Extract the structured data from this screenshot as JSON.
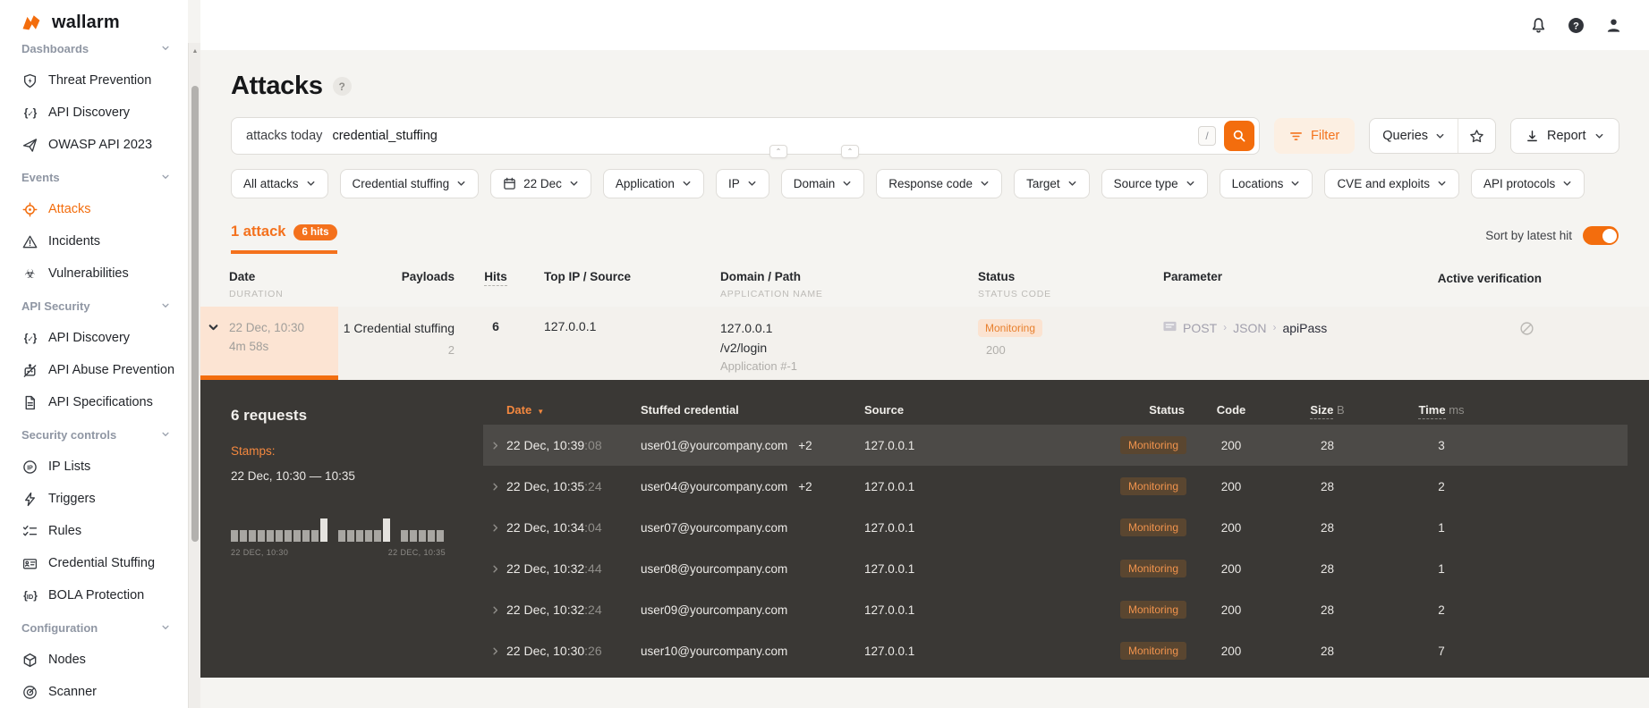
{
  "brand": {
    "name": "wallarm",
    "accent": "#f36d0d"
  },
  "topbar": {
    "icons": [
      "bell",
      "help",
      "user"
    ]
  },
  "sidebar": {
    "sections": [
      {
        "header": "Dashboards",
        "items": [
          {
            "icon": "shield-bolt",
            "label": "Threat Prevention"
          },
          {
            "icon": "braces-check",
            "label": "API Discovery"
          },
          {
            "icon": "paper-plane",
            "label": "OWASP API 2023"
          }
        ]
      },
      {
        "header": "Events",
        "items": [
          {
            "icon": "target",
            "label": "Attacks",
            "active": true
          },
          {
            "icon": "warning-triangle",
            "label": "Incidents"
          },
          {
            "icon": "biohazard",
            "label": "Vulnerabilities"
          }
        ]
      },
      {
        "header": "API Security",
        "items": [
          {
            "icon": "braces-check",
            "label": "API Discovery"
          },
          {
            "icon": "robot-crossed",
            "label": "API Abuse Prevention"
          },
          {
            "icon": "document",
            "label": "API Specifications"
          }
        ]
      },
      {
        "header": "Security controls",
        "items": [
          {
            "icon": "ip-badge",
            "label": "IP Lists"
          },
          {
            "icon": "lightning",
            "label": "Triggers"
          },
          {
            "icon": "checklist",
            "label": "Rules"
          },
          {
            "icon": "id-card",
            "label": "Credential Stuffing"
          },
          {
            "icon": "braces-id",
            "label": "BOLA Protection"
          }
        ]
      },
      {
        "header": "Configuration",
        "items": [
          {
            "icon": "hexagon-node",
            "label": "Nodes"
          },
          {
            "icon": "radar",
            "label": "Scanner"
          }
        ]
      }
    ]
  },
  "page": {
    "title": "Attacks"
  },
  "search": {
    "tokens": {
      "scope": "attacks today",
      "type": "credential_stuffing"
    },
    "shortcut": "/"
  },
  "toolbar": {
    "filter_label": "Filter",
    "queries_label": "Queries",
    "report_label": "Report"
  },
  "filters": {
    "chips": [
      {
        "label": "All attacks"
      },
      {
        "label": "Credential stuffing"
      },
      {
        "icon": "calendar",
        "label": "22 Dec"
      },
      {
        "label": "Application"
      },
      {
        "label": "IP"
      },
      {
        "label": "Domain"
      },
      {
        "label": "Response code"
      },
      {
        "label": "Target"
      },
      {
        "label": "Source type"
      },
      {
        "label": "Locations"
      },
      {
        "label": "CVE and exploits"
      },
      {
        "label": "API protocols"
      }
    ]
  },
  "tabs": {
    "attacks_label": "1 attack",
    "hits_badge": "6 hits"
  },
  "sort": {
    "label": "Sort by latest hit",
    "enabled": true
  },
  "attacks_table": {
    "headers": {
      "date": "Date",
      "date_sub": "DURATION",
      "payloads": "Payloads",
      "hits": "Hits",
      "top_ip": "Top IP / Source",
      "domain": "Domain / Path",
      "domain_sub": "APPLICATION NAME",
      "status": "Status",
      "status_sub": "STATUS CODE",
      "parameter": "Parameter",
      "active_verification": "Active verification"
    }
  },
  "attack": {
    "date": "22 Dec, 10:30",
    "duration": "4m 58s",
    "payloads": "1 Credential stuffing",
    "payloads_count": "2",
    "hits": "6",
    "top_ip": "127.0.0.1",
    "domain": "127.0.0.1",
    "path": "/v2/login",
    "application": "Application #-1",
    "status": "Monitoring",
    "status_code": "200",
    "parameter": {
      "method": "POST",
      "format": "JSON",
      "name": "apiPass"
    }
  },
  "detail": {
    "title": "6 requests",
    "stamps_label": "Stamps:",
    "time_range": "22 Dec, 10:30 — 10:35",
    "histogram": {
      "bars": [
        13,
        13,
        13,
        13,
        13,
        13,
        13,
        13,
        13,
        13,
        26,
        0,
        13,
        13,
        13,
        13,
        13,
        26,
        0,
        13,
        13,
        13,
        13,
        13
      ],
      "start_label": "22 DEC, 10:30",
      "end_label": "22 DEC, 10:35"
    },
    "headers": {
      "date": "Date",
      "credential": "Stuffed credential",
      "source": "Source",
      "status": "Status",
      "code": "Code",
      "size": "Size",
      "size_unit": "B",
      "time": "Time",
      "time_unit": "ms"
    },
    "rows": [
      {
        "date": "22 Dec, 10:39",
        "seconds": ":08",
        "credential": "user01@yourcompany.com",
        "extra": "+2",
        "source": "127.0.0.1",
        "status": "Monitoring",
        "code": "200",
        "size": "28",
        "time": "3",
        "highlighted": true
      },
      {
        "date": "22 Dec, 10:35",
        "seconds": ":24",
        "credential": "user04@yourcompany.com",
        "extra": "+2",
        "source": "127.0.0.1",
        "status": "Monitoring",
        "code": "200",
        "size": "28",
        "time": "2"
      },
      {
        "date": "22 Dec, 10:34",
        "seconds": ":04",
        "credential": "user07@yourcompany.com",
        "extra": "",
        "source": "127.0.0.1",
        "status": "Monitoring",
        "code": "200",
        "size": "28",
        "time": "1"
      },
      {
        "date": "22 Dec, 10:32",
        "seconds": ":44",
        "credential": "user08@yourcompany.com",
        "extra": "",
        "source": "127.0.0.1",
        "status": "Monitoring",
        "code": "200",
        "size": "28",
        "time": "1"
      },
      {
        "date": "22 Dec, 10:32",
        "seconds": ":24",
        "credential": "user09@yourcompany.com",
        "extra": "",
        "source": "127.0.0.1",
        "status": "Monitoring",
        "code": "200",
        "size": "28",
        "time": "2"
      },
      {
        "date": "22 Dec, 10:30",
        "seconds": ":26",
        "credential": "user10@yourcompany.com",
        "extra": "",
        "source": "127.0.0.1",
        "status": "Monitoring",
        "code": "200",
        "size": "28",
        "time": "7"
      }
    ]
  },
  "colors": {
    "accent": "#f36d0d",
    "monitoring_light_bg": "#fbe3d1",
    "monitoring_light_text": "#e8812f",
    "monitoring_dark_bg": "#5a4630",
    "monitoring_dark_text": "#f0934d",
    "panel_bg": "#3a3835"
  }
}
